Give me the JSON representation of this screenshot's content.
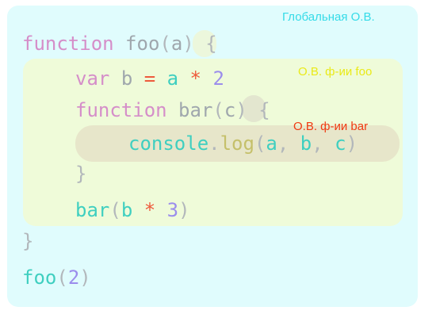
{
  "scope_labels": {
    "global": "Глобальная О.В.",
    "foo": "О.В. ф-ии foo",
    "bar": "О.В. ф-ии bar"
  },
  "code": {
    "line1": {
      "keyword": "function",
      "name": "foo",
      "open_paren": "(",
      "param": "a",
      "close_paren": ")",
      "brace": "{"
    },
    "line2": {
      "keyword": "var",
      "var_name": "b",
      "assign": "=",
      "operand": "a",
      "operator": "*",
      "number": "2"
    },
    "line3": {
      "keyword": "function",
      "name": "bar",
      "open_paren": "(",
      "param": "c",
      "close_paren": ")",
      "brace": "{"
    },
    "line4": {
      "object": "console",
      "dot": ".",
      "method": "log",
      "open_paren": "(",
      "arg1": "a",
      "comma1": ",",
      "arg2": "b",
      "comma2": ",",
      "arg3": "c",
      "close_paren": ")"
    },
    "line5": {
      "brace": "}"
    },
    "line6": {
      "call": "bar",
      "open_paren": "(",
      "arg": "b",
      "operator": "*",
      "number": "3",
      "close_paren": ")"
    },
    "line7": {
      "brace": "}"
    },
    "line8": {
      "call": "foo",
      "open_paren": "(",
      "number": "2",
      "close_paren": ")"
    }
  },
  "colors": {
    "global_scope": "#e0fcfd",
    "foo_scope": "#effbd9",
    "bar_scope": "#e7e6ca",
    "label_global": "#34dbe8",
    "label_foo": "#eaea18",
    "label_bar": "#f03a12",
    "keyword": "#d58ec9",
    "identifier": "#9fa7ad",
    "number": "#9b8dec",
    "operator": "#ee5a3c",
    "function_call": "#3fcfc0"
  }
}
